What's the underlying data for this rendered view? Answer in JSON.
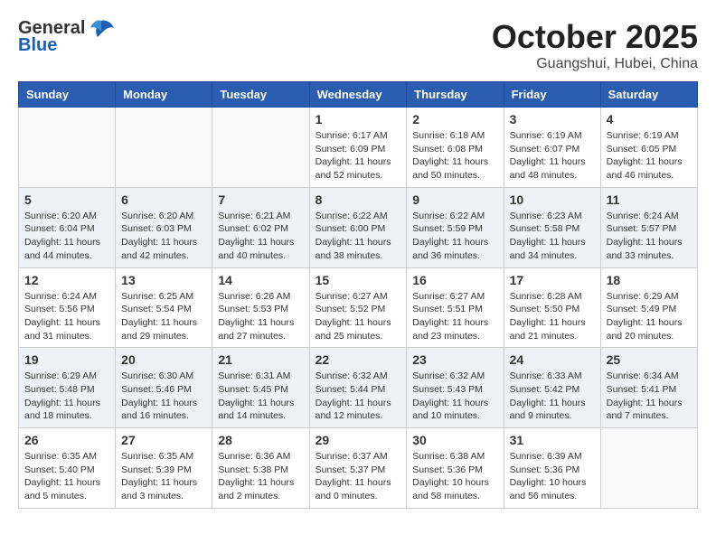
{
  "header": {
    "logo_general": "General",
    "logo_blue": "Blue",
    "month_title": "October 2025",
    "location": "Guangshui, Hubei, China"
  },
  "days_of_week": [
    "Sunday",
    "Monday",
    "Tuesday",
    "Wednesday",
    "Thursday",
    "Friday",
    "Saturday"
  ],
  "weeks": [
    [
      {
        "day": "",
        "info": ""
      },
      {
        "day": "",
        "info": ""
      },
      {
        "day": "",
        "info": ""
      },
      {
        "day": "1",
        "info": "Sunrise: 6:17 AM\nSunset: 6:09 PM\nDaylight: 11 hours\nand 52 minutes."
      },
      {
        "day": "2",
        "info": "Sunrise: 6:18 AM\nSunset: 6:08 PM\nDaylight: 11 hours\nand 50 minutes."
      },
      {
        "day": "3",
        "info": "Sunrise: 6:19 AM\nSunset: 6:07 PM\nDaylight: 11 hours\nand 48 minutes."
      },
      {
        "day": "4",
        "info": "Sunrise: 6:19 AM\nSunset: 6:05 PM\nDaylight: 11 hours\nand 46 minutes."
      }
    ],
    [
      {
        "day": "5",
        "info": "Sunrise: 6:20 AM\nSunset: 6:04 PM\nDaylight: 11 hours\nand 44 minutes."
      },
      {
        "day": "6",
        "info": "Sunrise: 6:20 AM\nSunset: 6:03 PM\nDaylight: 11 hours\nand 42 minutes."
      },
      {
        "day": "7",
        "info": "Sunrise: 6:21 AM\nSunset: 6:02 PM\nDaylight: 11 hours\nand 40 minutes."
      },
      {
        "day": "8",
        "info": "Sunrise: 6:22 AM\nSunset: 6:00 PM\nDaylight: 11 hours\nand 38 minutes."
      },
      {
        "day": "9",
        "info": "Sunrise: 6:22 AM\nSunset: 5:59 PM\nDaylight: 11 hours\nand 36 minutes."
      },
      {
        "day": "10",
        "info": "Sunrise: 6:23 AM\nSunset: 5:58 PM\nDaylight: 11 hours\nand 34 minutes."
      },
      {
        "day": "11",
        "info": "Sunrise: 6:24 AM\nSunset: 5:57 PM\nDaylight: 11 hours\nand 33 minutes."
      }
    ],
    [
      {
        "day": "12",
        "info": "Sunrise: 6:24 AM\nSunset: 5:56 PM\nDaylight: 11 hours\nand 31 minutes."
      },
      {
        "day": "13",
        "info": "Sunrise: 6:25 AM\nSunset: 5:54 PM\nDaylight: 11 hours\nand 29 minutes."
      },
      {
        "day": "14",
        "info": "Sunrise: 6:26 AM\nSunset: 5:53 PM\nDaylight: 11 hours\nand 27 minutes."
      },
      {
        "day": "15",
        "info": "Sunrise: 6:27 AM\nSunset: 5:52 PM\nDaylight: 11 hours\nand 25 minutes."
      },
      {
        "day": "16",
        "info": "Sunrise: 6:27 AM\nSunset: 5:51 PM\nDaylight: 11 hours\nand 23 minutes."
      },
      {
        "day": "17",
        "info": "Sunrise: 6:28 AM\nSunset: 5:50 PM\nDaylight: 11 hours\nand 21 minutes."
      },
      {
        "day": "18",
        "info": "Sunrise: 6:29 AM\nSunset: 5:49 PM\nDaylight: 11 hours\nand 20 minutes."
      }
    ],
    [
      {
        "day": "19",
        "info": "Sunrise: 6:29 AM\nSunset: 5:48 PM\nDaylight: 11 hours\nand 18 minutes."
      },
      {
        "day": "20",
        "info": "Sunrise: 6:30 AM\nSunset: 5:46 PM\nDaylight: 11 hours\nand 16 minutes."
      },
      {
        "day": "21",
        "info": "Sunrise: 6:31 AM\nSunset: 5:45 PM\nDaylight: 11 hours\nand 14 minutes."
      },
      {
        "day": "22",
        "info": "Sunrise: 6:32 AM\nSunset: 5:44 PM\nDaylight: 11 hours\nand 12 minutes."
      },
      {
        "day": "23",
        "info": "Sunrise: 6:32 AM\nSunset: 5:43 PM\nDaylight: 11 hours\nand 10 minutes."
      },
      {
        "day": "24",
        "info": "Sunrise: 6:33 AM\nSunset: 5:42 PM\nDaylight: 11 hours\nand 9 minutes."
      },
      {
        "day": "25",
        "info": "Sunrise: 6:34 AM\nSunset: 5:41 PM\nDaylight: 11 hours\nand 7 minutes."
      }
    ],
    [
      {
        "day": "26",
        "info": "Sunrise: 6:35 AM\nSunset: 5:40 PM\nDaylight: 11 hours\nand 5 minutes."
      },
      {
        "day": "27",
        "info": "Sunrise: 6:35 AM\nSunset: 5:39 PM\nDaylight: 11 hours\nand 3 minutes."
      },
      {
        "day": "28",
        "info": "Sunrise: 6:36 AM\nSunset: 5:38 PM\nDaylight: 11 hours\nand 2 minutes."
      },
      {
        "day": "29",
        "info": "Sunrise: 6:37 AM\nSunset: 5:37 PM\nDaylight: 11 hours\nand 0 minutes."
      },
      {
        "day": "30",
        "info": "Sunrise: 6:38 AM\nSunset: 5:36 PM\nDaylight: 10 hours\nand 58 minutes."
      },
      {
        "day": "31",
        "info": "Sunrise: 6:39 AM\nSunset: 5:36 PM\nDaylight: 10 hours\nand 56 minutes."
      },
      {
        "day": "",
        "info": ""
      }
    ]
  ]
}
